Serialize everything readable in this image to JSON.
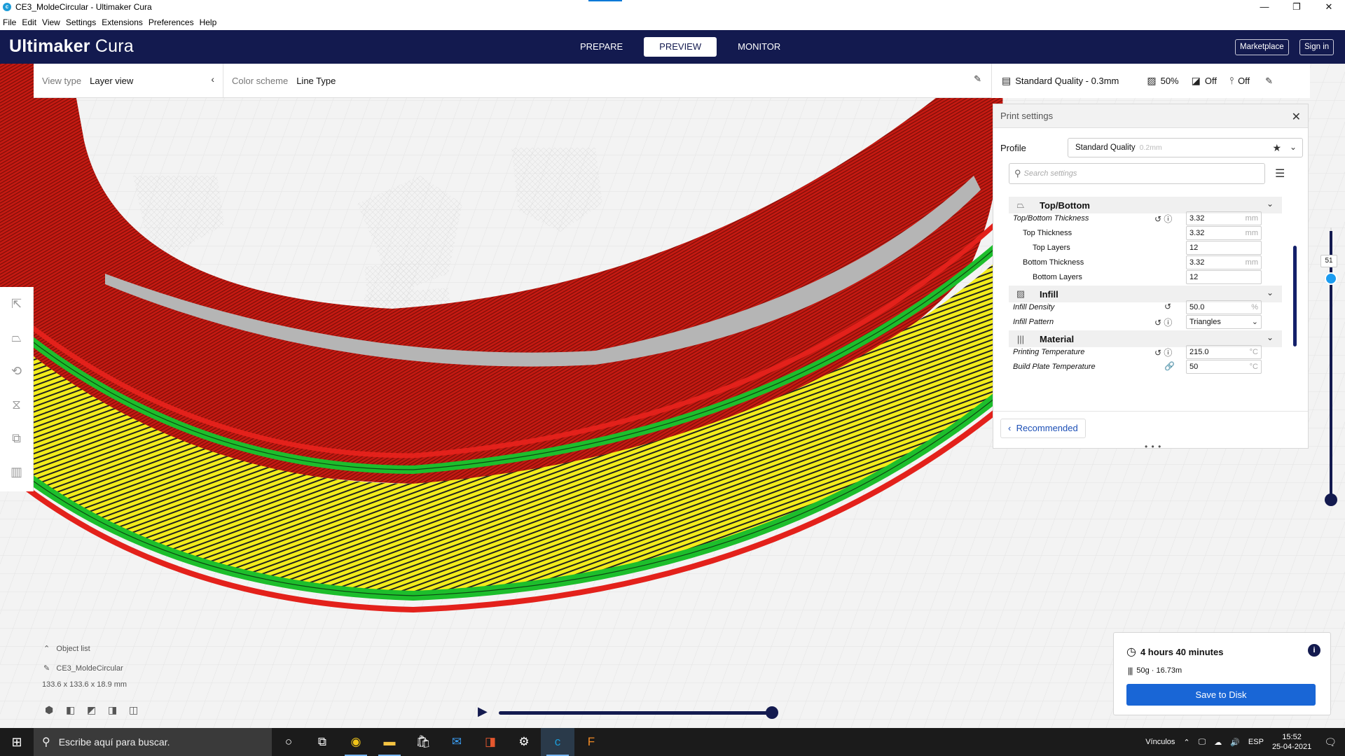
{
  "window": {
    "title": "CE3_MoldeCircular - Ultimaker Cura",
    "controls": {
      "minimize": "—",
      "maximize": "❐",
      "close": "✕"
    }
  },
  "menu": [
    "File",
    "Edit",
    "View",
    "Settings",
    "Extensions",
    "Preferences",
    "Help"
  ],
  "header": {
    "logo_bold": "Ultimaker",
    "logo_light": " Cura",
    "stages": [
      "PREPARE",
      "PREVIEW",
      "MONITOR"
    ],
    "active_stage": "PREVIEW",
    "marketplace": "Marketplace",
    "sign_in": "Sign in"
  },
  "viewbar": {
    "view_type_label": "View type",
    "view_type_value": "Layer view",
    "color_scheme_label": "Color scheme",
    "color_scheme_value": "Line Type"
  },
  "quality_bar": {
    "profile": "Standard Quality - 0.3mm",
    "infill": "50%",
    "support": "Off",
    "adhesion": "Off"
  },
  "print_settings": {
    "title": "Print settings",
    "profile_label": "Profile",
    "profile_value": "Standard Quality",
    "profile_sub": "0.2mm",
    "search_placeholder": "Search settings",
    "categories": [
      {
        "name": "Top/Bottom"
      },
      {
        "name": "Infill"
      },
      {
        "name": "Material"
      }
    ],
    "settings": [
      {
        "label": "Top/Bottom Thickness",
        "value": "3.32",
        "unit": "mm"
      },
      {
        "label": "Top Thickness",
        "value": "3.32",
        "unit": "mm"
      },
      {
        "label": "Top Layers",
        "value": "12",
        "unit": ""
      },
      {
        "label": "Bottom Thickness",
        "value": "3.32",
        "unit": "mm"
      },
      {
        "label": "Bottom Layers",
        "value": "12",
        "unit": ""
      },
      {
        "label": "Infill Density",
        "value": "50.0",
        "unit": "%"
      },
      {
        "label": "Infill Pattern",
        "value": "Triangles",
        "unit": ""
      },
      {
        "label": "Printing Temperature",
        "value": "215.0",
        "unit": "°C"
      },
      {
        "label": "Build Plate Temperature",
        "value": "50",
        "unit": "°C"
      }
    ],
    "recommended_btn": "Recommended"
  },
  "layer_slider": {
    "current": "51"
  },
  "object_list": {
    "header": "Object list",
    "name": "CE3_MoldeCircular",
    "dimensions": "133.6 x 133.6 x 18.9 mm"
  },
  "output": {
    "time": "4 hours 40 minutes",
    "material": "50g · 16.73m",
    "save_btn": "Save to Disk"
  },
  "taskbar": {
    "search_placeholder": "Escribe aquí para buscar.",
    "tray_links": "Vínculos",
    "lang": "ESP",
    "time": "15:52",
    "date": "25-04-2021"
  },
  "colors": {
    "header_bg": "#131a4f",
    "accent_blue": "#1966d6",
    "wall_red": "#e3211b",
    "wall_green": "#1dbe2c",
    "skin_yellow": "#f4ee1d",
    "skirt_cyan": "#22d6e6"
  }
}
